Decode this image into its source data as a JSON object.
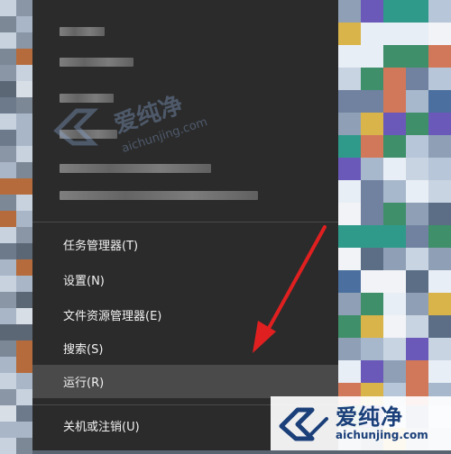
{
  "menu": {
    "items": [
      {
        "label": "任务管理器(T)",
        "highlighted": false
      },
      {
        "label": "设置(N)",
        "highlighted": false
      },
      {
        "label": "文件资源管理器(E)",
        "highlighted": false
      },
      {
        "label": "搜索(S)",
        "highlighted": false
      },
      {
        "label": "运行(R)",
        "highlighted": true
      },
      {
        "label": "关机或注销(U)",
        "highlighted": false
      }
    ]
  },
  "watermark": {
    "cn": "爱纯净",
    "en": "aichunjing.com"
  },
  "colors": {
    "menu_bg": "#2b2b2b",
    "highlight_bg": "#4a4a4a",
    "arrow": "#e02020",
    "watermark_text": "#1a3f79"
  }
}
